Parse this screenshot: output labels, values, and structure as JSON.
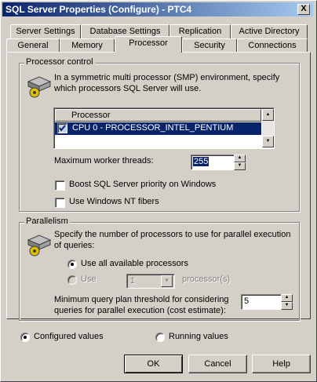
{
  "window": {
    "title": "SQL Server Properties (Configure)  - PTC4",
    "close_glyph": "X"
  },
  "tabs_row1": [
    "Server Settings",
    "Database Settings",
    "Replication",
    "Active Directory"
  ],
  "tabs_row2": [
    "General",
    "Memory",
    "Processor",
    "Security",
    "Connections"
  ],
  "active_tab": "Processor",
  "processor_control": {
    "legend": "Processor control",
    "description": "In a symmetric multi processor (SMP) environment, specify which processors SQL Server will use.",
    "list_header": "Processor",
    "processors": [
      {
        "label": "CPU 0 - PROCESSOR_INTEL_PENTIUM",
        "checked": true
      }
    ],
    "max_threads_label": "Maximum worker threads:",
    "max_threads_value": "255",
    "boost_label": "Boost SQL Server priority on Windows",
    "boost_checked": false,
    "fibers_label": "Use Windows NT fibers",
    "fibers_checked": false
  },
  "parallelism": {
    "legend": "Parallelism",
    "description": "Specify the number of processors to use for parallel execution of queries:",
    "use_all_label": "Use all available processors",
    "use_label": "Use",
    "use_count_value": "1",
    "processors_suffix": "processor(s)",
    "threshold_label_line1": "Minimum query plan threshold for considering",
    "threshold_label_line2": "queries for parallel execution (cost estimate):",
    "threshold_value": "5"
  },
  "view_mode": {
    "configured_label": "Configured values",
    "running_label": "Running values",
    "selected": "configured"
  },
  "buttons": {
    "ok": "OK",
    "cancel": "Cancel",
    "help": "Help"
  },
  "icons": [
    "gear-chip-icon",
    "checkbox-checked-icon",
    "spin-up-icon",
    "spin-down-icon",
    "dropdown-arrow-icon",
    "scroll-up-icon",
    "scroll-down-icon",
    "close-icon"
  ]
}
